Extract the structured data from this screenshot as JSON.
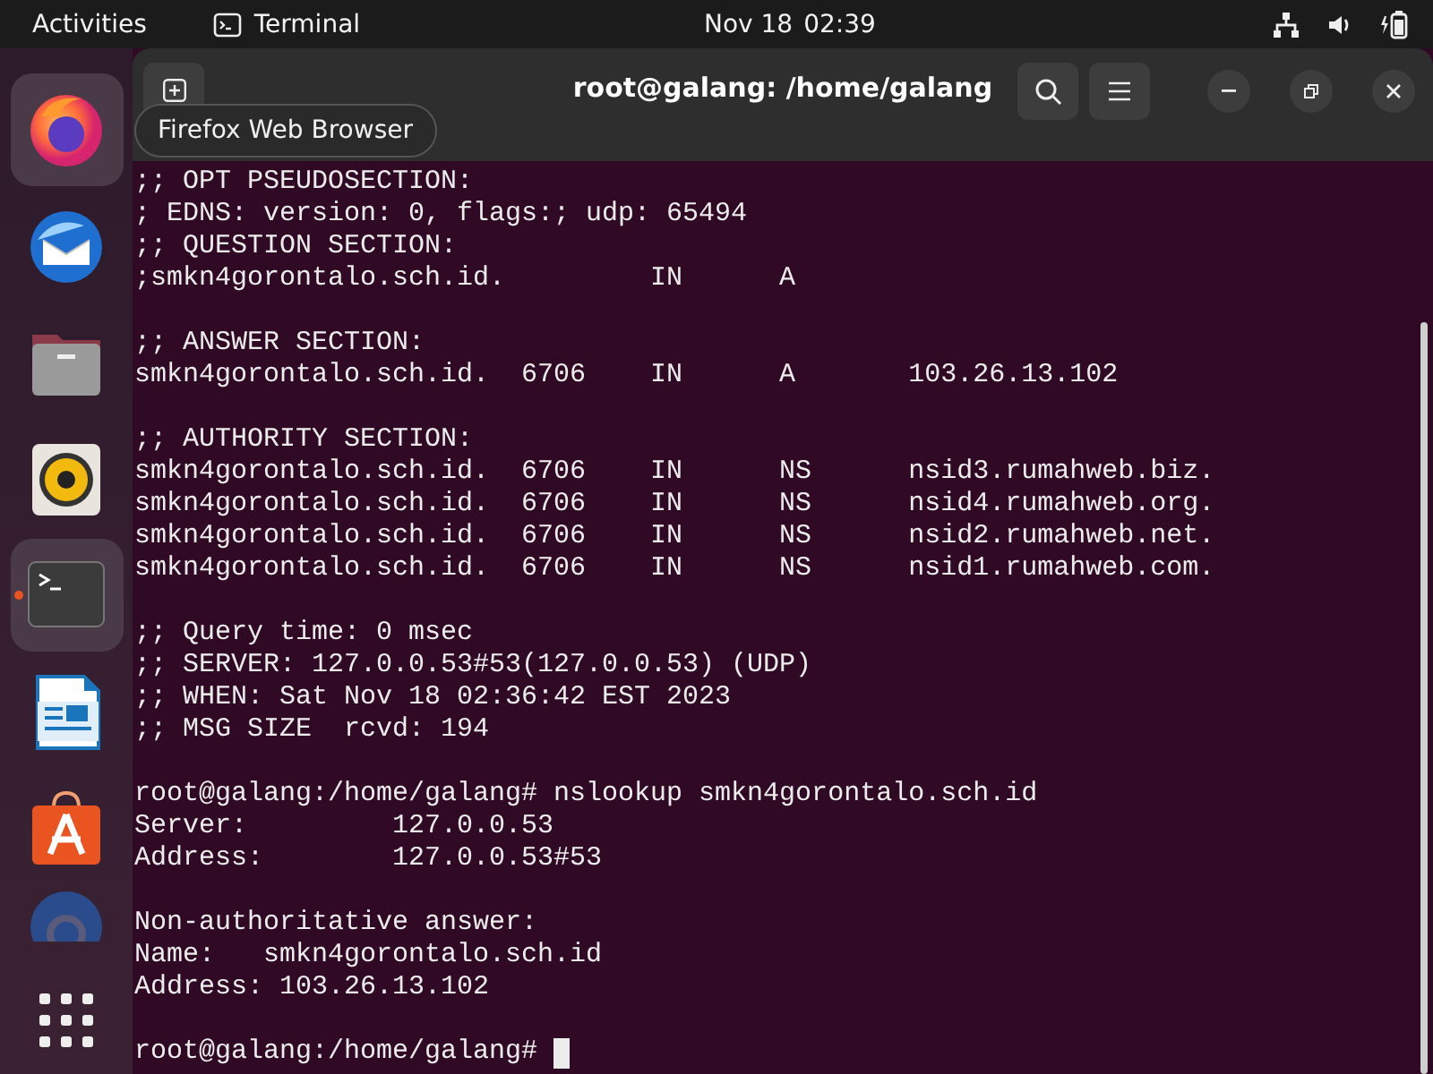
{
  "top_bar": {
    "activities": "Activities",
    "app_name": "Terminal",
    "date": "Nov 18",
    "time": "02:39"
  },
  "dock": {
    "apps": [
      {
        "kind": "firefox",
        "highlighted": true,
        "running": false
      },
      {
        "kind": "thunderbird",
        "highlighted": false,
        "running": false
      },
      {
        "kind": "files",
        "highlighted": false,
        "running": false
      },
      {
        "kind": "rhythmbox",
        "highlighted": false,
        "running": false
      },
      {
        "kind": "terminal",
        "highlighted": true,
        "running": true
      },
      {
        "kind": "writer",
        "highlighted": false,
        "running": false
      },
      {
        "kind": "appcenter",
        "highlighted": false,
        "running": false
      },
      {
        "kind": "help",
        "highlighted": false,
        "running": false
      }
    ],
    "tooltip": "Firefox Web Browser"
  },
  "window": {
    "title": "root@galang: /home/galang"
  },
  "terminal": {
    "blocks": [
      [
        ";; OPT PSEUDOSECTION:",
        "; EDNS: version: 0, flags:; udp: 65494",
        ";; QUESTION SECTION:",
        ";smkn4gorontalo.sch.id.         IN      A"
      ],
      [
        ";; ANSWER SECTION:",
        "smkn4gorontalo.sch.id.  6706    IN      A       103.26.13.102"
      ],
      [
        ";; AUTHORITY SECTION:",
        "smkn4gorontalo.sch.id.  6706    IN      NS      nsid3.rumahweb.biz.",
        "smkn4gorontalo.sch.id.  6706    IN      NS      nsid4.rumahweb.org.",
        "smkn4gorontalo.sch.id.  6706    IN      NS      nsid2.rumahweb.net.",
        "smkn4gorontalo.sch.id.  6706    IN      NS      nsid1.rumahweb.com."
      ],
      [
        ";; Query time: 0 msec",
        ";; SERVER: 127.0.0.53#53(127.0.0.53) (UDP)",
        ";; WHEN: Sat Nov 18 02:36:42 EST 2023",
        ";; MSG SIZE  rcvd: 194"
      ],
      [
        "root@galang:/home/galang# nslookup smkn4gorontalo.sch.id",
        "Server:         127.0.0.53",
        "Address:        127.0.0.53#53"
      ],
      [
        "Non-authoritative answer:",
        "Name:   smkn4gorontalo.sch.id",
        "Address: 103.26.13.102"
      ]
    ],
    "prompt": {
      "text": "root@galang:/home/galang# ",
      "cursor": true
    }
  }
}
